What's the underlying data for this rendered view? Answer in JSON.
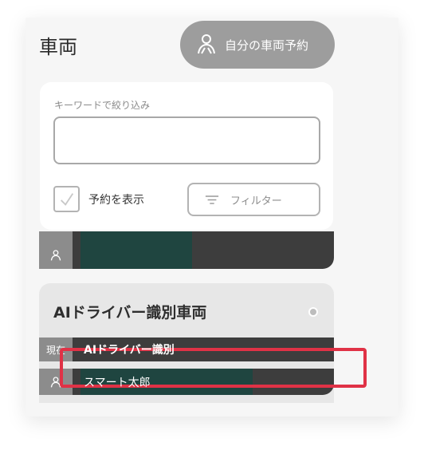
{
  "header": {
    "title": "車両",
    "reserve_button_label": "自分の車両予約"
  },
  "search": {
    "label": "キーワードで絞り込み",
    "value": "",
    "placeholder": ""
  },
  "options": {
    "show_reservation_label": "予約を表示",
    "show_reservation_checked": false,
    "filter_label": "フィルター"
  },
  "vehicle_list": {
    "first_row_text": ""
  },
  "group": {
    "title": "AIドライバー識別車両",
    "current_badge": "現在",
    "current_text": "AIドライバー識別",
    "driver_name": "スマート太郎"
  },
  "colors": {
    "accent_highlight": "#e03246",
    "bar_green": "#1f4540",
    "row_dark": "#3d3d3d",
    "button_gray": "#9d9d9d"
  }
}
